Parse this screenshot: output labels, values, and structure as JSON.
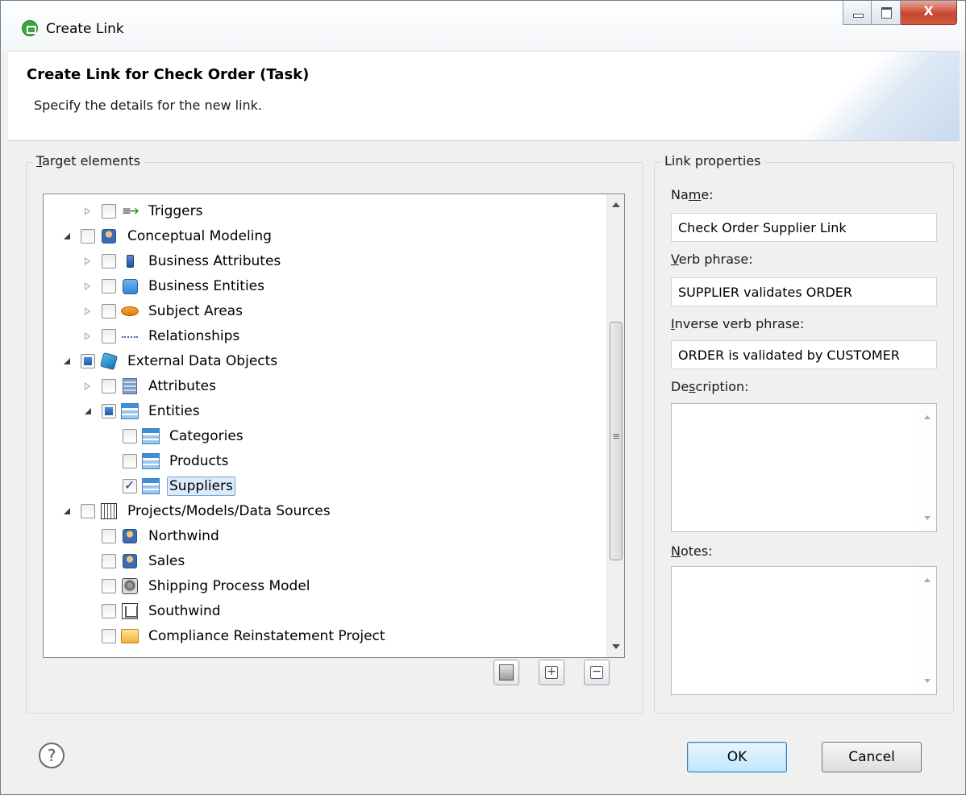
{
  "window": {
    "title": "Create Link",
    "close_glyph": "X"
  },
  "header": {
    "title": "Create Link for Check Order (Task)",
    "description": "Specify the details for the new link."
  },
  "target": {
    "label_accel": "T",
    "label_rest": "arget elements",
    "tree": [
      {
        "label": "Triggers",
        "indent": 1,
        "expander": "closed",
        "check": "none",
        "icon": "trigger-icon"
      },
      {
        "label": "Conceptual Modeling",
        "indent": 0,
        "expander": "open",
        "check": "none",
        "icon": "person-model-icon"
      },
      {
        "label": "Business Attributes",
        "indent": 1,
        "expander": "closed",
        "check": "none",
        "icon": "business-attribute-icon"
      },
      {
        "label": "Business Entities",
        "indent": 1,
        "expander": "closed",
        "check": "none",
        "icon": "business-entity-icon"
      },
      {
        "label": "Subject Areas",
        "indent": 1,
        "expander": "closed",
        "check": "none",
        "icon": "subject-area-icon"
      },
      {
        "label": "Relationships",
        "indent": 1,
        "expander": "closed",
        "check": "none",
        "icon": "relationship-icon"
      },
      {
        "label": "External Data Objects",
        "indent": 0,
        "expander": "open",
        "check": "partial",
        "icon": "data-cube-icon"
      },
      {
        "label": "Attributes",
        "indent": 1,
        "expander": "closed",
        "check": "none",
        "icon": "attribute-icon"
      },
      {
        "label": "Entities",
        "indent": 1,
        "expander": "open",
        "check": "partial",
        "icon": "table-icon"
      },
      {
        "label": "Categories",
        "indent": 2,
        "expander": "none",
        "check": "none",
        "icon": "table-icon"
      },
      {
        "label": "Products",
        "indent": 2,
        "expander": "none",
        "check": "none",
        "icon": "table-icon"
      },
      {
        "label": "Suppliers",
        "indent": 2,
        "expander": "none",
        "check": "checked",
        "icon": "table-icon",
        "selected": true
      },
      {
        "label": "Projects/Models/Data Sources",
        "indent": 0,
        "expander": "open",
        "check": "none",
        "icon": "projects-icon"
      },
      {
        "label": "Northwind",
        "indent": 1,
        "expander": "none",
        "check": "none",
        "icon": "person-model-icon"
      },
      {
        "label": "Sales",
        "indent": 1,
        "expander": "none",
        "check": "none",
        "icon": "person-model-icon"
      },
      {
        "label": "Shipping Process Model",
        "indent": 1,
        "expander": "none",
        "check": "none",
        "icon": "process-model-icon"
      },
      {
        "label": "Southwind",
        "indent": 1,
        "expander": "none",
        "check": "none",
        "icon": "org-model-icon"
      },
      {
        "label": "Compliance Reinstatement Project",
        "indent": 1,
        "expander": "none",
        "check": "none",
        "icon": "folder-icon"
      }
    ],
    "expand_glyph": "+",
    "collapse_glyph": "−"
  },
  "props": {
    "title": "Link properties",
    "name_label": {
      "pre": "Na",
      "accel": "m",
      "post": "e:"
    },
    "name_value": "Check Order Supplier Link",
    "verb_label": {
      "pre": "",
      "accel": "V",
      "post": "erb phrase:"
    },
    "verb_value": "SUPPLIER validates ORDER",
    "inverse_label": {
      "pre": "",
      "accel": "I",
      "post": "nverse verb phrase:"
    },
    "inverse_value": "ORDER is validated by CUSTOMER",
    "desc_label": {
      "pre": "De",
      "accel": "s",
      "post": "cription:"
    },
    "notes_label": {
      "pre": "",
      "accel": "N",
      "post": "otes:"
    }
  },
  "footer": {
    "help_glyph": "?",
    "ok_label": "OK",
    "cancel_label": "Cancel"
  }
}
